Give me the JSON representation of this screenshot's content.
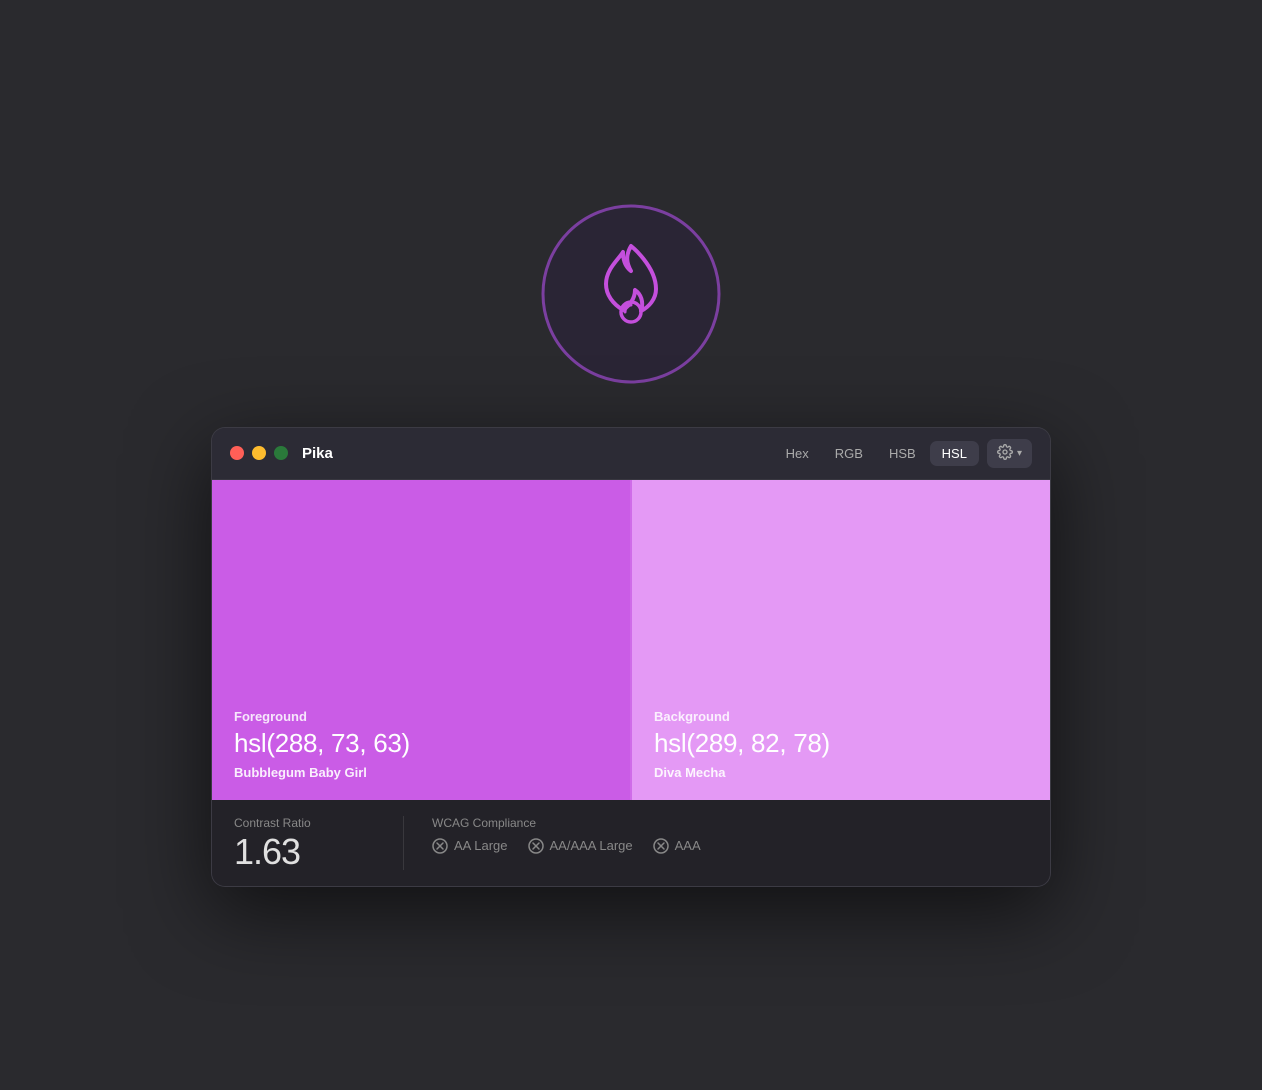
{
  "app": {
    "icon_label": "Pika app icon"
  },
  "window": {
    "title": "Pika",
    "traffic_lights": {
      "red_label": "Close",
      "yellow_label": "Minimize",
      "green_label": "Maximize"
    },
    "format_tabs": [
      {
        "label": "Hex",
        "active": false
      },
      {
        "label": "RGB",
        "active": false
      },
      {
        "label": "HSB",
        "active": false
      },
      {
        "label": "HSL",
        "active": true
      }
    ],
    "settings_label": "Settings",
    "foreground": {
      "label": "Foreground",
      "value": "hsl(288, 73, 63)",
      "name": "Bubblegum Baby Girl"
    },
    "background": {
      "label": "Background",
      "value": "hsl(289, 82, 78)",
      "name": "Diva Mecha"
    },
    "contrast": {
      "label": "Contrast Ratio",
      "value": "1.63"
    },
    "wcag": {
      "label": "WCAG Compliance",
      "items": [
        {
          "label": "AA Large",
          "pass": false
        },
        {
          "label": "AA/AAA Large",
          "pass": false
        },
        {
          "label": "AAA",
          "pass": false
        }
      ]
    }
  }
}
